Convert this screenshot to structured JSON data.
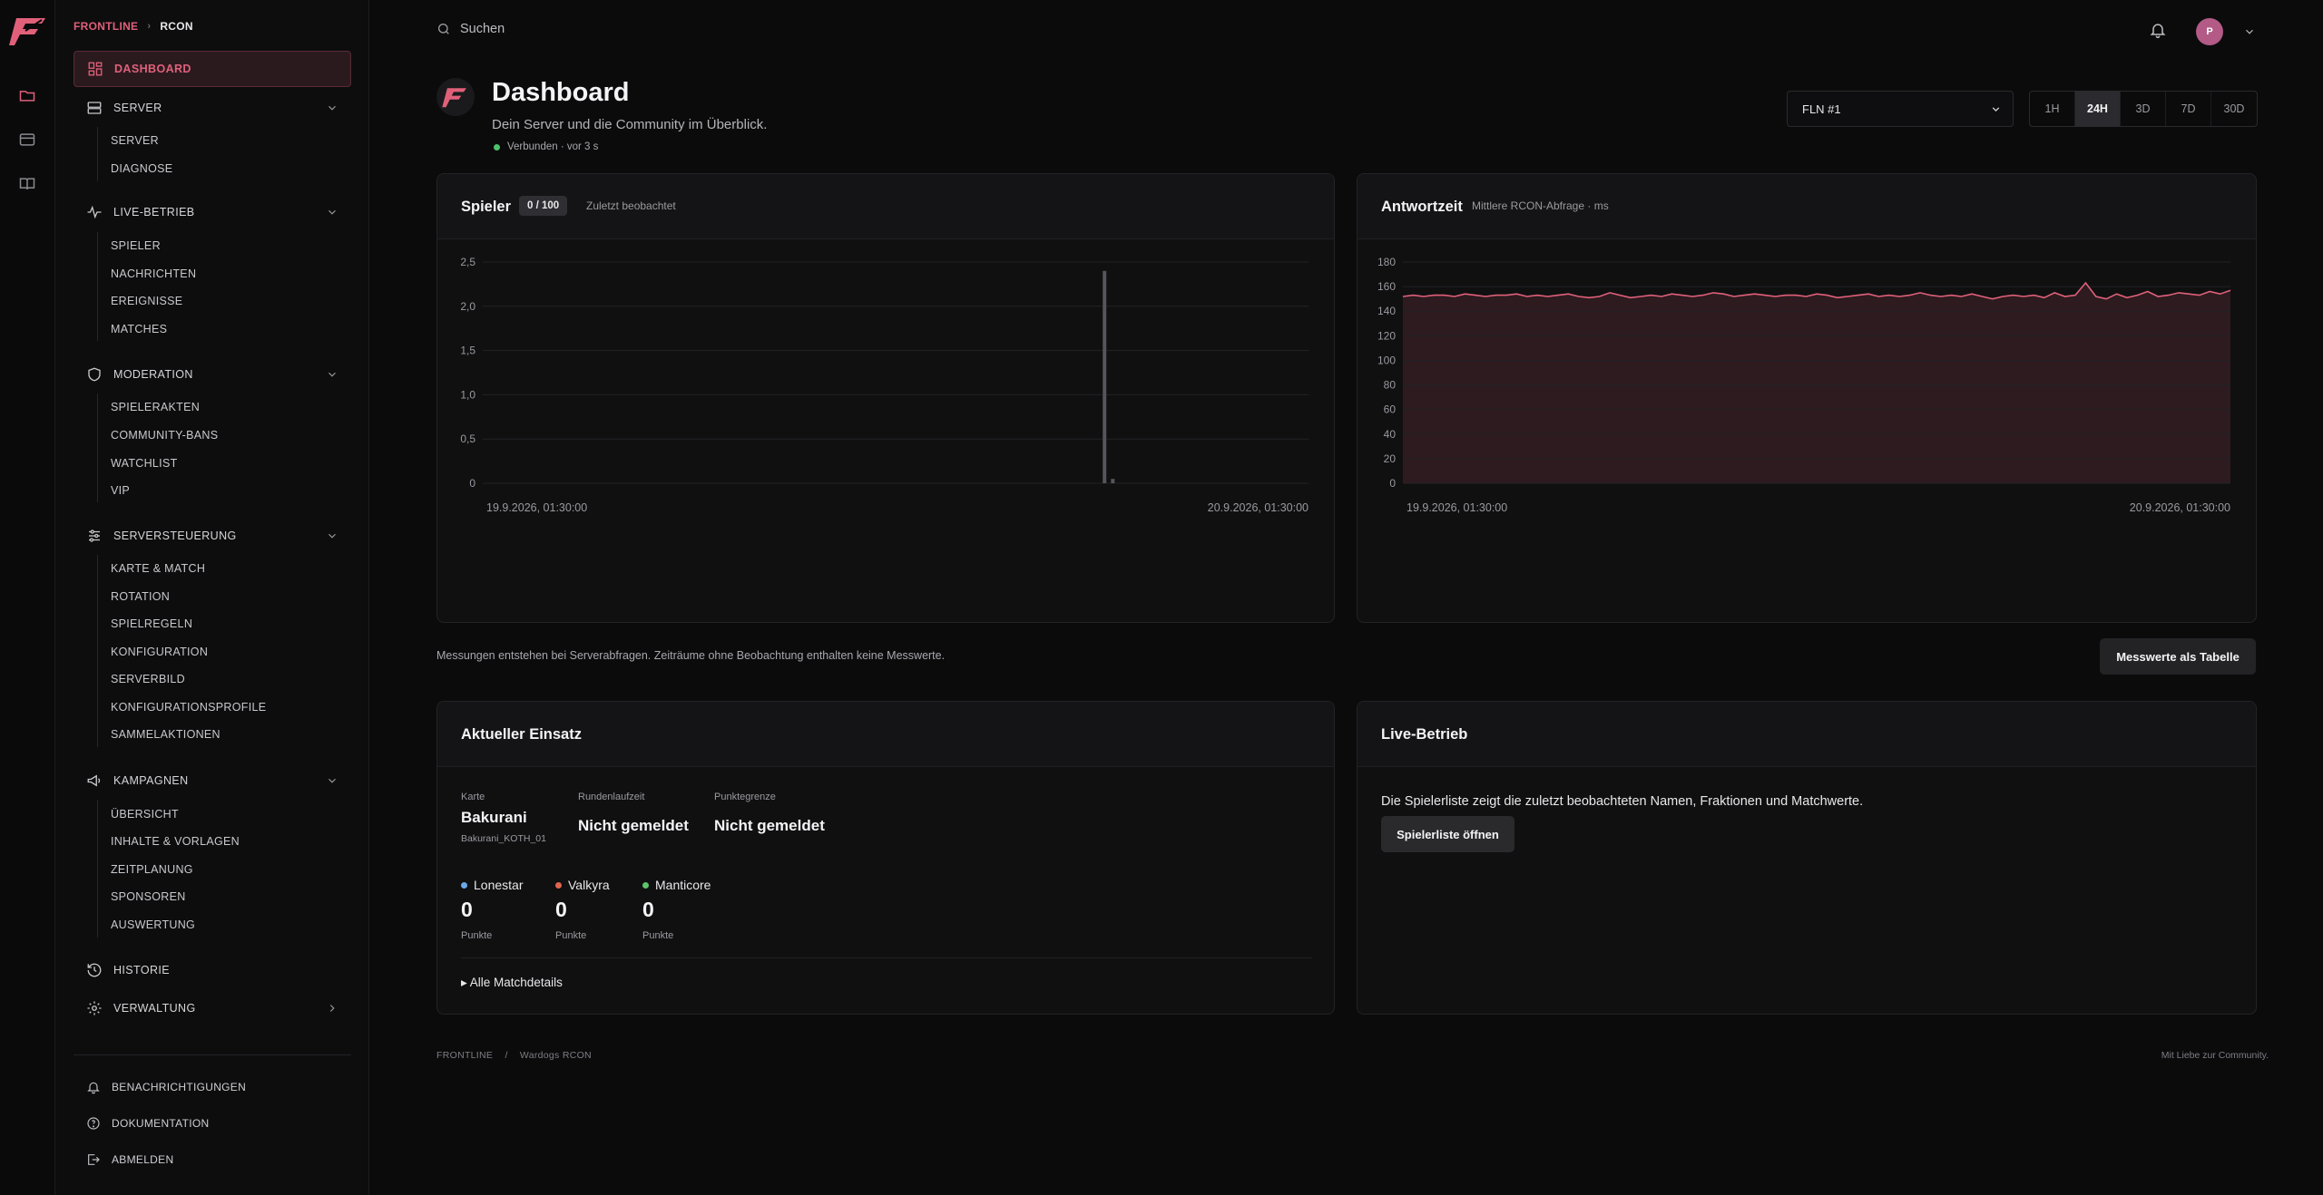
{
  "brand": {
    "accent": "#e0607a",
    "logo_icon": "frontline-f-logo"
  },
  "breadcrumb": {
    "items": [
      "FRONTLINE",
      "RCON"
    ]
  },
  "rail": {
    "icons": [
      "folder-icon",
      "card-icon",
      "book-icon"
    ]
  },
  "sidebar": {
    "dashboard": "DASHBOARD",
    "sections": [
      {
        "label": "SERVER",
        "icon": "server-icon",
        "items": [
          "SERVER",
          "DIAGNOSE"
        ]
      },
      {
        "label": "LIVE-BETRIEB",
        "icon": "activity-icon",
        "items": [
          "SPIELER",
          "NACHRICHTEN",
          "EREIGNISSE",
          "MATCHES"
        ]
      },
      {
        "label": "MODERATION",
        "icon": "shield-icon",
        "items": [
          "SPIELERAKTEN",
          "COMMUNITY-BANS",
          "WATCHLIST",
          "VIP"
        ]
      },
      {
        "label": "SERVERSTEUERUNG",
        "icon": "sliders-icon",
        "items": [
          "KARTE & MATCH",
          "ROTATION",
          "SPIELREGELN",
          "KONFIGURATION",
          "SERVERBILD",
          "KONFIGURATIONSPROFILE",
          "SAMMELAKTIONEN"
        ]
      },
      {
        "label": "KAMPAGNEN",
        "icon": "megaphone-icon",
        "items": [
          "ÜBERSICHT",
          "INHALTE & VORLAGEN",
          "ZEITPLANUNG",
          "SPONSOREN",
          "AUSWERTUNG"
        ]
      }
    ],
    "historie": "HISTORIE",
    "verwaltung": "VERWALTUNG",
    "footer": [
      "BENACHRICHTIGUNGEN",
      "DOKUMENTATION",
      "ABMELDEN"
    ]
  },
  "topbar": {
    "search_placeholder": "Suchen",
    "avatar_initial": "P"
  },
  "header": {
    "title": "Dashboard",
    "subtitle": "Dein Server und die Community im Überblick.",
    "status": "Verbunden · vor 3 s",
    "server_select": "FLN #1",
    "ranges": [
      "1H",
      "24H",
      "3D",
      "7D",
      "30D"
    ],
    "active_range": "24H"
  },
  "players_card": {
    "title": "Spieler",
    "badge": "0 / 100",
    "note": "Zuletzt beobachtet"
  },
  "latency_card": {
    "title": "Antwortzeit",
    "note": "Mittlere RCON-Abfrage · ms"
  },
  "chart_data": [
    {
      "type": "bar",
      "title": "Spieler",
      "x_start": "19.9.2026, 01:30:00",
      "x_end": "20.9.2026, 01:30:00",
      "y_ticks": [
        "0",
        "0,5",
        "1,0",
        "1,5",
        "2,0",
        "2,5"
      ],
      "ylim": [
        0,
        2.5
      ],
      "bars": [
        {
          "t": 0.753,
          "value": 2.4
        },
        {
          "t": 0.763,
          "value": 0.05
        }
      ],
      "grid": true
    },
    {
      "type": "area",
      "title": "Antwortzeit",
      "x_start": "19.9.2026, 01:30:00",
      "x_end": "20.9.2026, 01:30:00",
      "y_ticks": [
        "0",
        "20",
        "40",
        "60",
        "80",
        "100",
        "120",
        "140",
        "160",
        "180"
      ],
      "ylim": [
        0,
        180
      ],
      "color": "#e0607a",
      "values": [
        152,
        153,
        152,
        153,
        153,
        152,
        154,
        153,
        152,
        153,
        153,
        154,
        152,
        153,
        152,
        153,
        154,
        152,
        151,
        152,
        155,
        153,
        151,
        152,
        153,
        152,
        154,
        153,
        152,
        153,
        155,
        154,
        152,
        153,
        154,
        153,
        152,
        153,
        153,
        152,
        154,
        153,
        151,
        152,
        153,
        154,
        152,
        153,
        152,
        153,
        155,
        153,
        152,
        153,
        152,
        154,
        152,
        150,
        152,
        153,
        152,
        153,
        151,
        155,
        152,
        153,
        163,
        152,
        150,
        154,
        151,
        153,
        156,
        152,
        153,
        155,
        154,
        153,
        156,
        154,
        157
      ],
      "grid": true
    }
  ],
  "measurement_note": "Messungen entstehen bei Serverabfragen. Zeiträume ohne Beobachtung enthalten keine Messwerte.",
  "table_button": "Messwerte als Tabelle",
  "deployment": {
    "title": "Aktueller Einsatz",
    "map_label": "Karte",
    "map_value": "Bakurani",
    "map_id": "Bakurani_KOTH_01",
    "round_label": "Rundenlaufzeit",
    "round_value": "Nicht gemeldet",
    "limit_label": "Punktegrenze",
    "limit_value": "Nicht gemeldet",
    "teams": [
      {
        "name": "Lonestar",
        "score": "0",
        "unit": "Punkte",
        "color": "#6aa8e8"
      },
      {
        "name": "Valkyra",
        "score": "0",
        "unit": "Punkte",
        "color": "#e0644e"
      },
      {
        "name": "Manticore",
        "score": "0",
        "unit": "Punkte",
        "color": "#5cc46a"
      }
    ],
    "details": "▸ Alle Matchdetails"
  },
  "live": {
    "title": "Live-Betrieb",
    "text": "Die Spielerliste zeigt die zuletzt beobachteten Namen, Fraktionen und Matchwerte.",
    "button": "Spielerliste öffnen"
  },
  "footer": {
    "left_1": "FRONTLINE",
    "sep": "/",
    "left_2": "Wardogs RCON",
    "right": "Mit Liebe zur Community."
  }
}
